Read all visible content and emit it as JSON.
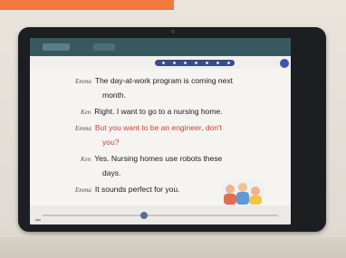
{
  "topbar": {
    "tab_a_label": "",
    "tab_b_label": ""
  },
  "toolbar": {
    "left_label": "",
    "zoom_label": "",
    "badge": ""
  },
  "dialogue": [
    {
      "speaker": "Emma",
      "text": "The day-at-work program is coming next",
      "highlight": false
    },
    {
      "speaker": "",
      "text": "month.",
      "highlight": false
    },
    {
      "speaker": "Ken",
      "text": "Right.  I want to go to a nursing home.",
      "highlight": false
    },
    {
      "speaker": "Emma",
      "text": "But you want to be an engineer, don't",
      "highlight": true
    },
    {
      "speaker": "",
      "text": "you?",
      "highlight": true
    },
    {
      "speaker": "Ken",
      "text": "Yes.  Nursing homes use robots these",
      "highlight": false
    },
    {
      "speaker": "",
      "text": "days.",
      "highlight": false
    },
    {
      "speaker": "Emma",
      "text": "It sounds perfect for you.",
      "highlight": false
    }
  ],
  "colors": {
    "orange_bar": "#ef7a3c",
    "topbar": "#37585f",
    "controls": "#3c4a8a",
    "highlight_text": "#d43b34"
  },
  "icons": [
    "play-controls-icon",
    "page-badge-icon",
    "slider-thumb-icon"
  ]
}
